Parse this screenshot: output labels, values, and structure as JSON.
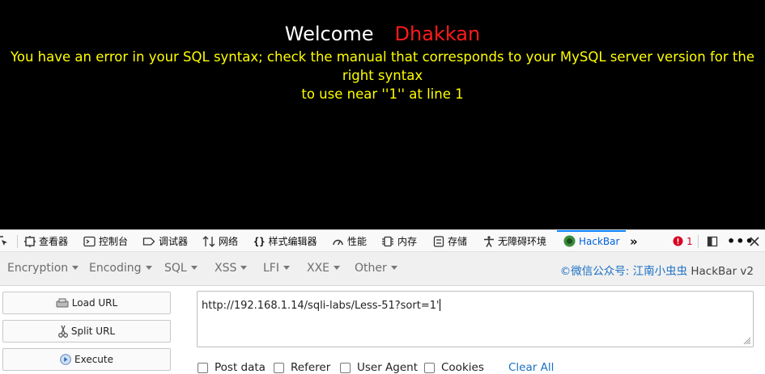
{
  "page": {
    "welcome": "Welcome",
    "user": "Dhakkan",
    "error_line1": "You have an error in your SQL syntax; check the manual that corresponds to your MySQL server version for the right syntax",
    "error_line2": "to use near ''1'' at line 1",
    "colors": {
      "background": "#000000",
      "welcome": "#ffffff",
      "user": "#ff1a1a",
      "error": "#ffff00"
    }
  },
  "devtools": {
    "tabs": [
      {
        "label": "查看器",
        "icon": "inspector-icon"
      },
      {
        "label": "控制台",
        "icon": "console-icon"
      },
      {
        "label": "调试器",
        "icon": "debugger-icon"
      },
      {
        "label": "网络",
        "icon": "network-icon"
      },
      {
        "label": "样式编辑器",
        "icon": "style-editor-icon"
      },
      {
        "label": "性能",
        "icon": "performance-icon"
      },
      {
        "label": "内存",
        "icon": "memory-icon"
      },
      {
        "label": "存储",
        "icon": "storage-icon"
      },
      {
        "label": "无障碍环境",
        "icon": "accessibility-icon"
      },
      {
        "label": "HackBar",
        "icon": "hackbar-icon",
        "active": true
      }
    ],
    "error_count": "1"
  },
  "hackbar": {
    "menu": [
      "Encryption",
      "Encoding",
      "SQL",
      "XSS",
      "LFI",
      "XXE",
      "Other"
    ],
    "brand_prefix": "©微信公众号: ",
    "brand_link": "江南小虫虫",
    "brand_suffix": " HackBar v2",
    "buttons": {
      "load": "Load URL",
      "split": "Split URL",
      "execute": "Execute"
    },
    "url": "http://192.168.1.14/sqli-labs/Less-51?sort=1'",
    "options": [
      "Post data",
      "Referer",
      "User Agent",
      "Cookies"
    ],
    "clear": "Clear All"
  }
}
